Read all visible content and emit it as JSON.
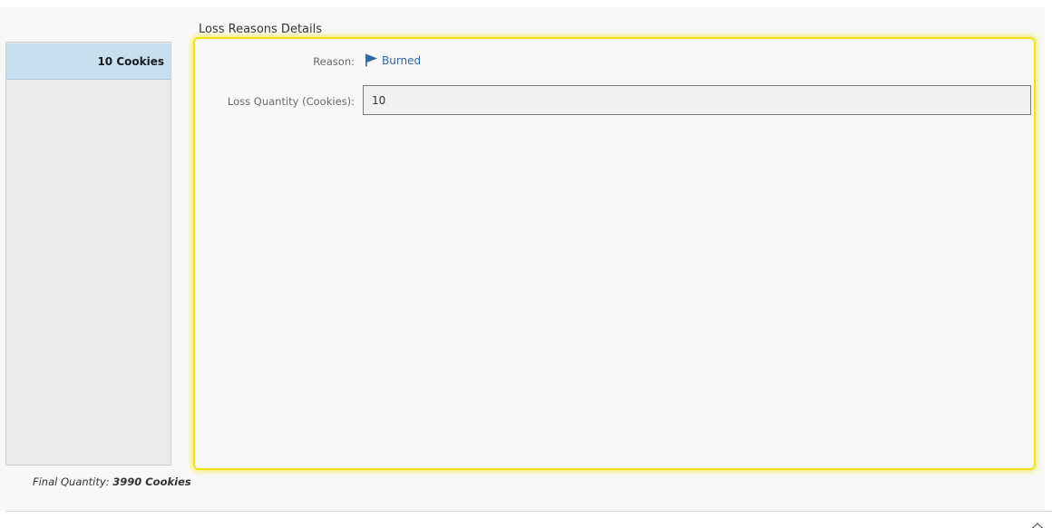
{
  "left_list": {
    "items": [
      {
        "label": "10 Cookies"
      }
    ],
    "final_quantity_label": "Final Quantity: ",
    "final_quantity_value": "3990 Cookies"
  },
  "details": {
    "title": "Loss Reasons Details",
    "reason_label": "Reason:",
    "reason_value": "Burned",
    "reason_icon": "flag-icon",
    "quantity_label": "Loss Quantity (Cookies):",
    "quantity_value": "10"
  },
  "footer": {
    "toggle_icon": "chevron-up-icon"
  },
  "colors": {
    "highlight_border": "#f2e01a",
    "selected_row": "#c8dff0",
    "link": "#2b6aa8"
  }
}
